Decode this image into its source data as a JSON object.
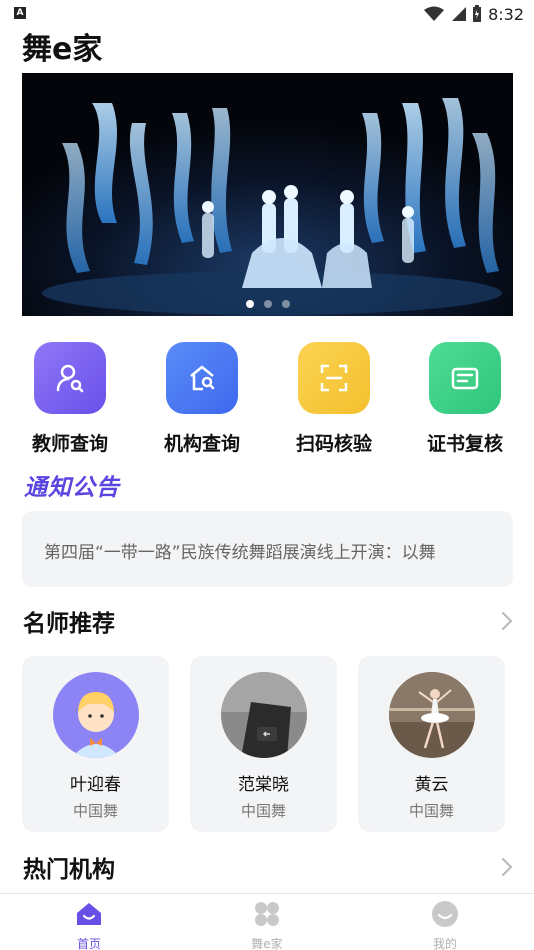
{
  "status_bar": {
    "time": "8:32",
    "notification_letter": "A"
  },
  "app": {
    "title": "舞e家"
  },
  "banner": {
    "dots": 3,
    "active_dot": 0
  },
  "quick_actions": [
    {
      "label": "教师查询",
      "icon": "teacher-search-icon",
      "color": "#7b61f2"
    },
    {
      "label": "机构查询",
      "icon": "institution-search-icon",
      "color": "#4f7df6"
    },
    {
      "label": "扫码核验",
      "icon": "scan-icon",
      "color": "#f7c93d"
    },
    {
      "label": "证书复核",
      "icon": "certificate-icon",
      "color": "#3fd08a"
    }
  ],
  "notice": {
    "title": "通知公告",
    "text": "第四届“一带一路”民族传统舞蹈展演线上开演：以舞"
  },
  "teachers": {
    "title": "名师推荐",
    "items": [
      {
        "name": "叶迎春",
        "category": "中国舞"
      },
      {
        "name": "范棠晓",
        "category": "中国舞"
      },
      {
        "name": "黄云",
        "category": "中国舞"
      }
    ]
  },
  "institutions": {
    "title": "热门机构"
  },
  "tabbar": {
    "items": [
      {
        "label": "首页",
        "icon": "home-icon",
        "active": true
      },
      {
        "label": "舞e家",
        "icon": "grid-icon",
        "active": false
      },
      {
        "label": "我的",
        "icon": "profile-icon",
        "active": false
      }
    ]
  }
}
